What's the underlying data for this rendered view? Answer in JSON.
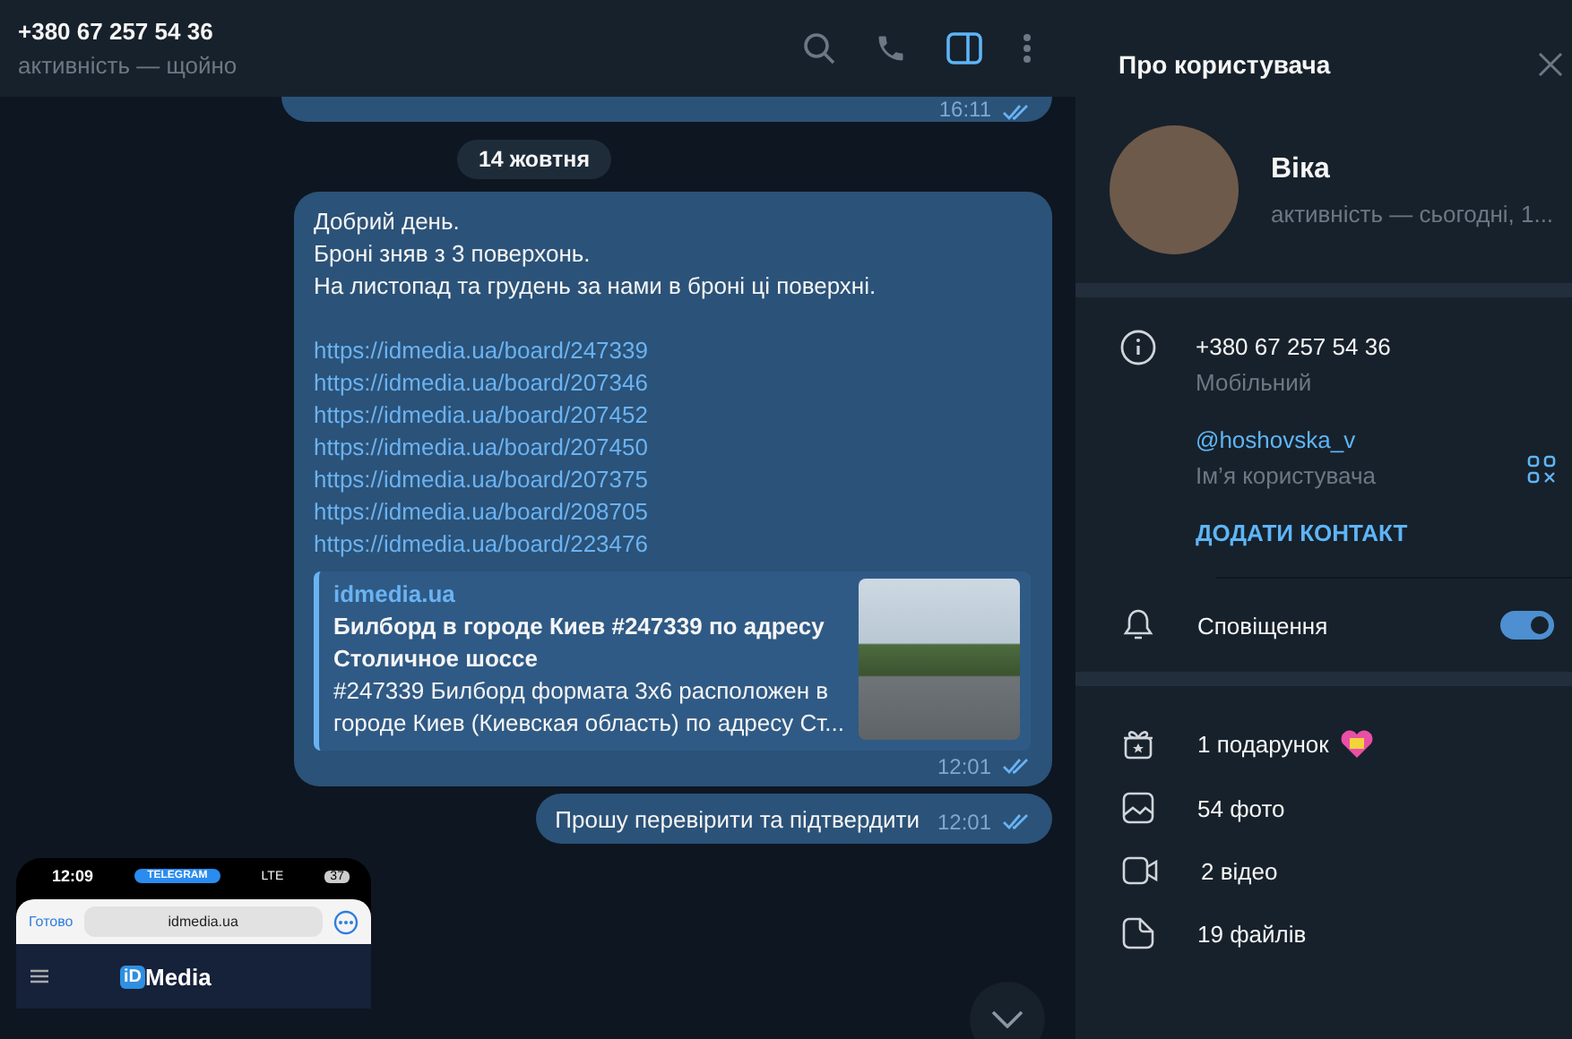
{
  "chat_header": {
    "title": "+380 67 257 54 36",
    "status": "активність — щойно",
    "panel_open": true
  },
  "messages": [
    {
      "kind": "cut",
      "out": true,
      "time": "16:11",
      "read": true
    },
    {
      "kind": "date",
      "text": "14 жовтня"
    },
    {
      "kind": "text",
      "out": true,
      "lines": [
        "Добрий день.",
        "Броні зняв з 3 поверхонь.",
        "На листопад та грудень за нами в броні ці поверхні."
      ],
      "links": [
        "https://idmedia.ua/board/247339",
        "https://idmedia.ua/board/207346",
        "https://idmedia.ua/board/207452",
        "https://idmedia.ua/board/207450",
        "https://idmedia.ua/board/207375",
        "https://idmedia.ua/board/208705",
        "https://idmedia.ua/board/223476"
      ],
      "preview": {
        "site": "idmedia.ua",
        "title": "Билборд в городе Киев #247339 по адресу Столичное шоссе",
        "description": "#247339 Билборд формата 3х6 расположен в городе Киев (Киевская область) по адресу Ст..."
      },
      "time": "12:01",
      "read": true
    },
    {
      "kind": "text",
      "out": true,
      "lines": [
        "Прошу перевірити та підтвердити"
      ],
      "time": "12:01",
      "read": true
    },
    {
      "kind": "screenshot",
      "out": false,
      "phone": {
        "time": "12:09",
        "badge": "TELEGRAM",
        "network": "LTE",
        "battery": "37",
        "done": "Готово",
        "url": "idmedia.ua",
        "logo_mark": "iD",
        "logo_text": "Media"
      }
    }
  ],
  "profile": {
    "title": "Про користувача",
    "name": "Віка",
    "status": "активність — сьогодні, 1...",
    "phone": "+380 67 257 54 36",
    "phone_label": "Мобільний",
    "username": "@hoshovska_v",
    "username_label": "Ім’я користувача",
    "add_contact": "ДОДАТИ КОНТАКТ",
    "notifications": {
      "label": "Сповіщення",
      "on": true
    },
    "media": [
      {
        "kind": "gift",
        "label": "1 подарунок"
      },
      {
        "kind": "photo",
        "label": "54 фото"
      },
      {
        "kind": "video",
        "label": "2 відео"
      },
      {
        "kind": "file",
        "label": "19 файлів"
      }
    ]
  }
}
